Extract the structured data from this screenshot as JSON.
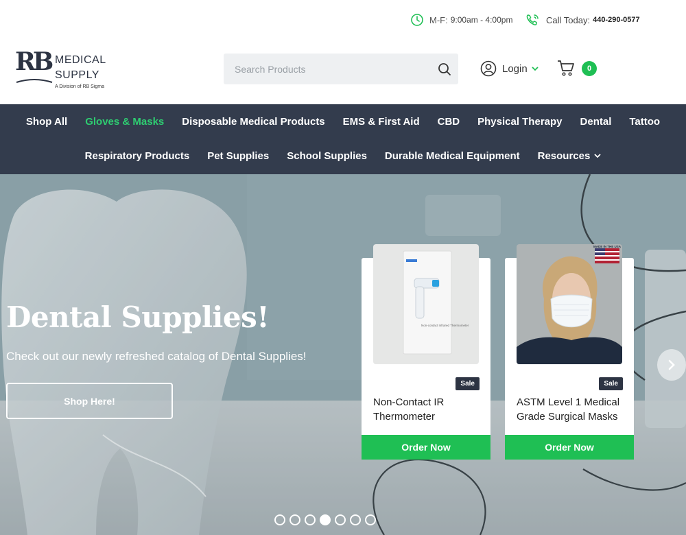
{
  "topbar": {
    "hours_label": "M-F:",
    "hours_value": "9:00am - 4:00pm",
    "call_label": "Call Today:",
    "call_number": "440-290-0577"
  },
  "brand": {
    "mark": "RB",
    "line1": "MEDICAL",
    "line2": "SUPPLY",
    "division": "A Division of RB Sigma"
  },
  "search": {
    "placeholder": "Search Products",
    "value": ""
  },
  "account": {
    "login_label": "Login"
  },
  "cart": {
    "count": "0"
  },
  "nav": {
    "row1": [
      "Shop All",
      "Gloves & Masks",
      "Disposable Medical Products",
      "EMS & First Aid",
      "CBD",
      "Physical Therapy",
      "Dental",
      "Tattoo"
    ],
    "row2": [
      "Respiratory Products",
      "Pet Supplies",
      "School Supplies",
      "Durable Medical Equipment",
      "Resources"
    ],
    "active": "Gloves & Masks"
  },
  "hero": {
    "title": "Dental Supplies!",
    "subtitle": "Check out our newly refreshed catalog of Dental Supplies!",
    "cta_label": "Shop Here!",
    "slide_count": 7,
    "active_slide": 4
  },
  "products": [
    {
      "name": "Non-Contact IR Thermometer",
      "badge": "Sale",
      "button": "Order Now",
      "image": "thermometer-box",
      "box_text": "Non-contact Infrared Thermometer"
    },
    {
      "name": "ASTM Level 1 Medical Grade Surgical Masks",
      "badge": "Sale",
      "button": "Order Now",
      "image": "woman-wearing-mask",
      "flag_text": "MADE IN THE USA"
    }
  ],
  "colors": {
    "accent_green": "#1fbf54",
    "nav_bg": "#333c4d",
    "brand_dark": "#2d3443"
  }
}
